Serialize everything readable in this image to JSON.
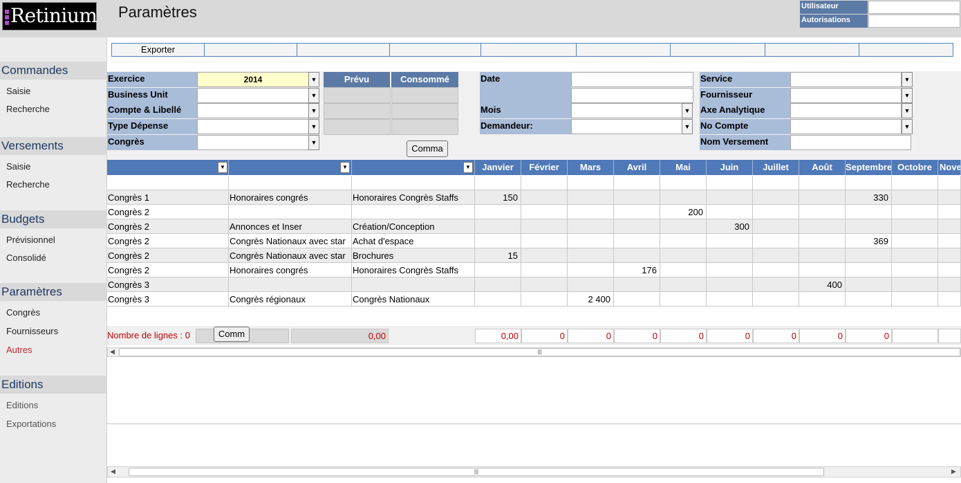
{
  "header": {
    "logo_text": "Retinium",
    "page_title": "Paramètres",
    "user_label": "Utilisateur",
    "user_value": "",
    "auth_label": "Autorisations",
    "auth_value": ""
  },
  "sidebar": {
    "sections": [
      {
        "title": "Commandes",
        "items": [
          "Saisie",
          "Recherche"
        ]
      },
      {
        "title": "Versements",
        "items": [
          "Saisie",
          "Recherche"
        ]
      },
      {
        "title": "Budgets",
        "items": [
          "Prévisionnel",
          "Consolidé"
        ]
      },
      {
        "title": "Paramètres",
        "items": [
          "Congrès",
          "Fournisseurs",
          "Autres"
        ]
      },
      {
        "title": "Editions",
        "items": [
          "Editions",
          "Exportations"
        ]
      }
    ],
    "active_item": "Autres",
    "colors": {
      "active": "#c0282e",
      "section_text": "#1f3864"
    }
  },
  "toolbar": {
    "buttons": [
      "Exporter",
      "",
      "",
      "",
      "",
      "",
      "",
      "",
      ""
    ]
  },
  "filters": {
    "exercice_label": "Exercice",
    "exercice_value": "2014",
    "business_unit_label": "Business Unit",
    "business_unit_value": "",
    "compte_label": "Compte & Libellé",
    "compte_value": "",
    "type_label": "Type Dépense",
    "type_value": "",
    "congres_label": "Congrès",
    "congres_value": "",
    "prevu_label": "Prévu",
    "consomme_label": "Consommé",
    "date_label": "Date",
    "mois_label": "Mois",
    "demandeur_label": "Demandeur:",
    "service_label": "Service",
    "fournisseur_label": "Fournisseur",
    "axe_label": "Axe Analytique",
    "no_compte_label": "No Compte",
    "nom_versement_label": "Nom Versement",
    "comma_button": "Comma"
  },
  "grid": {
    "months": [
      "Janvier",
      "Février",
      "Mars",
      "Avril",
      "Mai",
      "Juin",
      "Juillet",
      "Août",
      "Septembre",
      "Octobre",
      "Nove"
    ],
    "rows": [
      {
        "c1": "",
        "c2": "",
        "c3": "",
        "m": [
          "",
          "",
          "",
          "",
          "",
          "",
          "",
          "",
          "",
          "",
          ""
        ]
      },
      {
        "c1": "Congrès 1",
        "c2": "Honoraires congrés",
        "c3": "Honoraires Congrès Staffs",
        "m": [
          "150",
          "",
          "",
          "",
          "",
          "",
          "",
          "",
          "330",
          "",
          ""
        ]
      },
      {
        "c1": "Congrès 2",
        "c2": "",
        "c3": "",
        "m": [
          "",
          "",
          "",
          "",
          "200",
          "",
          "",
          "",
          "",
          "",
          ""
        ]
      },
      {
        "c1": "Congrès 2",
        "c2": "Annonces et Inser",
        "c3": "Création/Conception",
        "m": [
          "",
          "",
          "",
          "",
          "",
          "300",
          "",
          "",
          "",
          "",
          ""
        ]
      },
      {
        "c1": "Congrès 2",
        "c2": "Congrès Nationaux avec star",
        "c3": "Achat d'espace",
        "m": [
          "",
          "",
          "",
          "",
          "",
          "",
          "",
          "",
          "369",
          "",
          ""
        ]
      },
      {
        "c1": "Congrès 2",
        "c2": "Congrès Nationaux avec star",
        "c3": "Brochures",
        "m": [
          "15",
          "",
          "",
          "",
          "",
          "",
          "",
          "",
          "",
          "",
          ""
        ]
      },
      {
        "c1": "Congrès 2",
        "c2": "Honoraires congrés",
        "c3": "Honoraires Congrès Staffs",
        "m": [
          "",
          "",
          "",
          "176",
          "",
          "",
          "",
          "",
          "",
          "",
          ""
        ]
      },
      {
        "c1": "Congrès 3",
        "c2": "",
        "c3": "",
        "m": [
          "",
          "",
          "",
          "",
          "",
          "",
          "",
          "400",
          "",
          "",
          ""
        ]
      },
      {
        "c1": "Congrès 3",
        "c2": "Congrès régionaux",
        "c3": "Congrès Nationaux",
        "m": [
          "",
          "",
          "2 400",
          "",
          "",
          "",
          "",
          "",
          "",
          "",
          ""
        ]
      }
    ]
  },
  "footer": {
    "count_label": "Nombre de lignes : 0",
    "comm_button": "Comm",
    "total_value": "0,00",
    "month_totals": [
      "0,00",
      "0",
      "0",
      "0",
      "0",
      "0",
      "0",
      "0",
      "0",
      "",
      ""
    ]
  }
}
